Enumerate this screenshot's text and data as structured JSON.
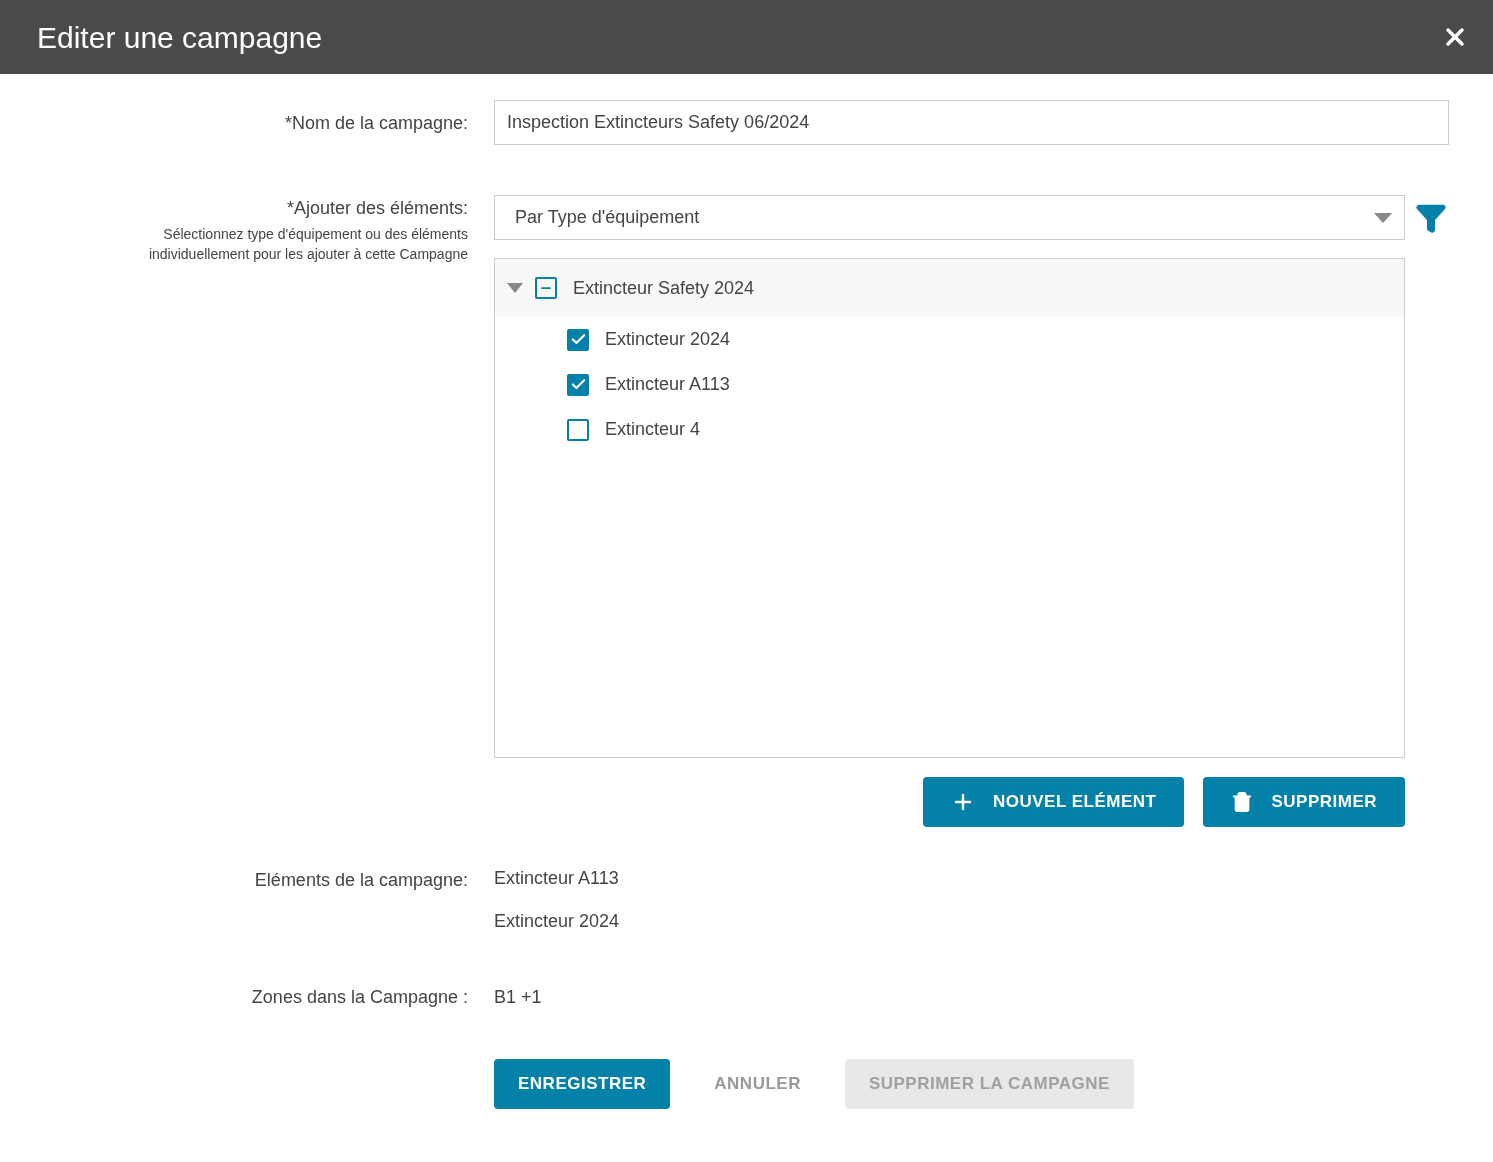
{
  "window": {
    "title": "Editer une campagne"
  },
  "name_field": {
    "label": "*Nom de la campagne:",
    "value": "Inspection Extincteurs Safety 06/2024"
  },
  "add_elements": {
    "label": "*Ajouter des éléments:",
    "hint": "Sélectionnez type d'équipement ou des éléments individuellement pour les ajouter à cette Campagne",
    "dropdown": {
      "value": "Par Type d'équipement"
    },
    "tree": [
      {
        "label": "Extincteur Safety 2024",
        "expanded": true,
        "indeterminate": true,
        "children": [
          {
            "label": "Extincteur 2024",
            "checked": true
          },
          {
            "label": "Extincteur A113",
            "checked": true
          },
          {
            "label": "Extincteur 4",
            "checked": false
          }
        ]
      }
    ],
    "buttons": [
      {
        "kind": "add",
        "label": "NOUVEL ELÉMENT"
      },
      {
        "kind": "delete",
        "label": "SUPPRIMER"
      }
    ]
  },
  "campaign_elements": {
    "label": "Eléments de la campagne:",
    "items": [
      "Extincteur A113",
      "Extincteur 2024"
    ]
  },
  "zones": {
    "label": "Zones dans la Campagne :",
    "value": "B1 +1"
  },
  "footer_buttons": [
    {
      "kind": "primary",
      "label": "ENREGISTRER",
      "disabled": false
    },
    {
      "kind": "text",
      "label": "ANNULER",
      "disabled": false
    },
    {
      "kind": "primary",
      "label": "SUPPRIMER LA CAMPAGNE",
      "disabled": true
    }
  ]
}
